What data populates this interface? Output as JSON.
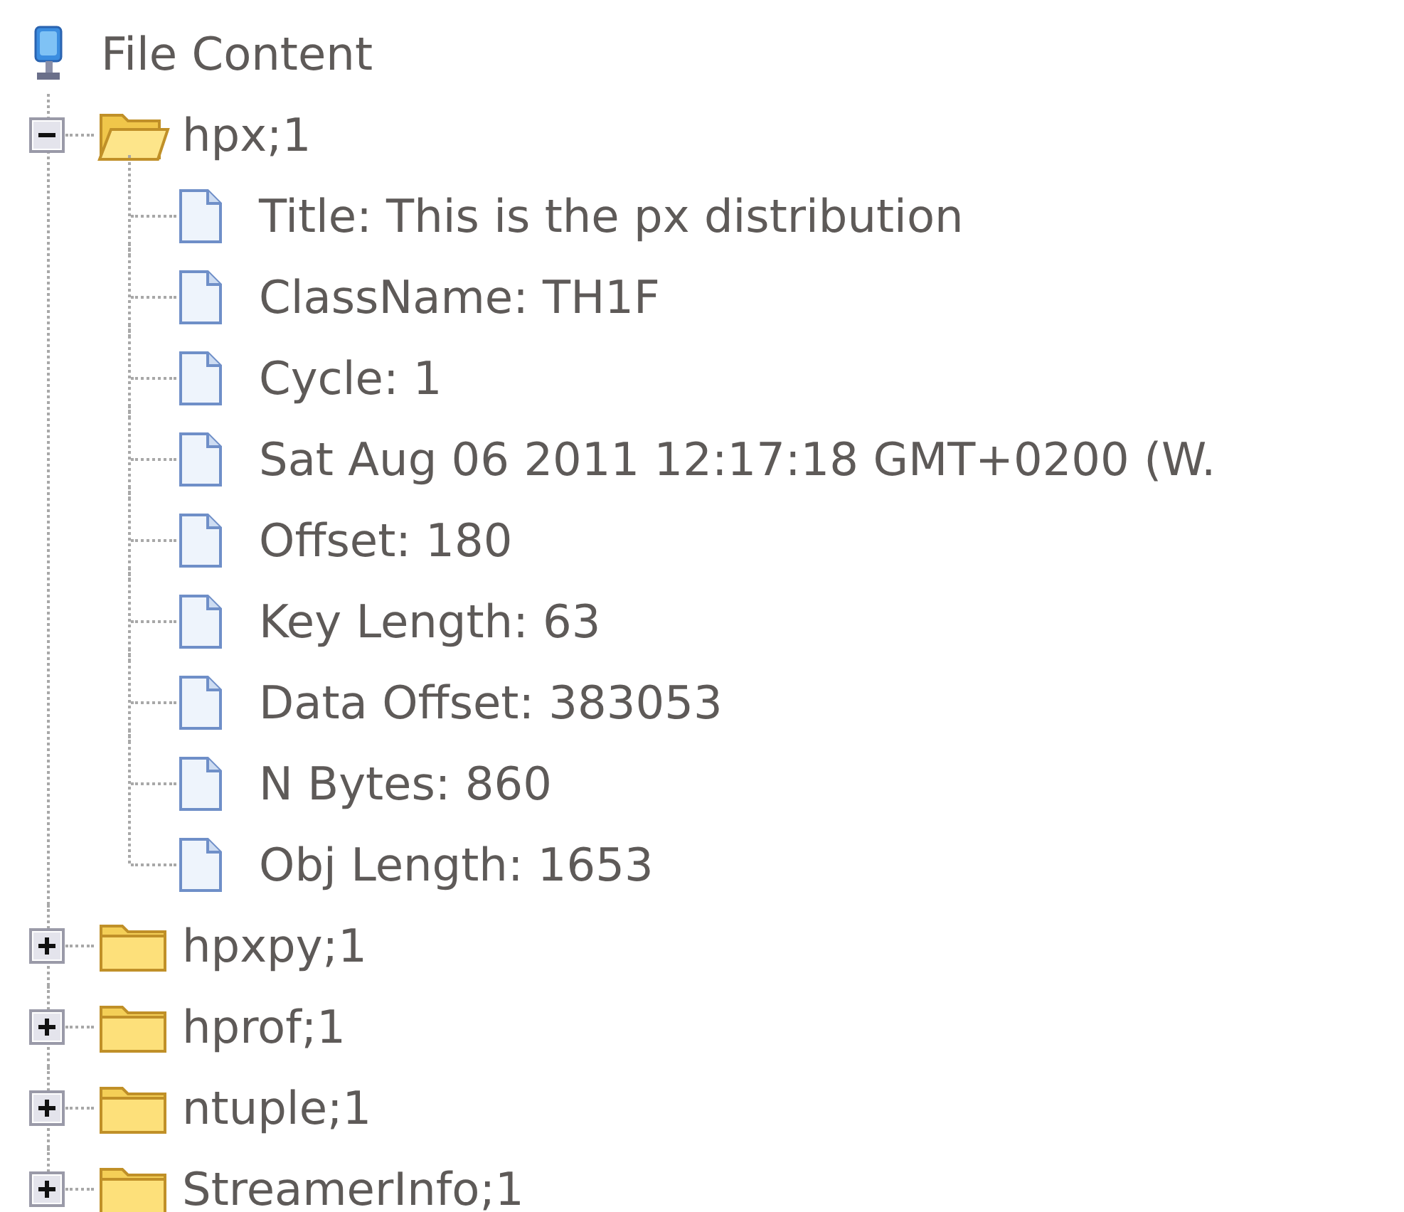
{
  "tree": {
    "label": "File Content",
    "children": [
      {
        "kind": "folder",
        "label": "hpx;1",
        "expanded": true,
        "children": [
          {
            "kind": "item",
            "label": "Title: This is the px distribution"
          },
          {
            "kind": "item",
            "label": "ClassName: TH1F"
          },
          {
            "kind": "item",
            "label": "Cycle: 1"
          },
          {
            "kind": "item",
            "label": "Sat Aug 06 2011 12:17:18 GMT+0200 (W."
          },
          {
            "kind": "item",
            "label": "Offset: 180"
          },
          {
            "kind": "item",
            "label": "Key Length: 63"
          },
          {
            "kind": "item",
            "label": "Data Offset: 383053"
          },
          {
            "kind": "item",
            "label": "N Bytes: 860"
          },
          {
            "kind": "item",
            "label": "Obj Length: 1653"
          }
        ]
      },
      {
        "kind": "folder",
        "label": "hpxpy;1",
        "expanded": false
      },
      {
        "kind": "folder",
        "label": "hprof;1",
        "expanded": false
      },
      {
        "kind": "folder",
        "label": "ntuple;1",
        "expanded": false
      },
      {
        "kind": "folder",
        "label": "StreamerInfo;1",
        "expanded": false
      }
    ]
  }
}
